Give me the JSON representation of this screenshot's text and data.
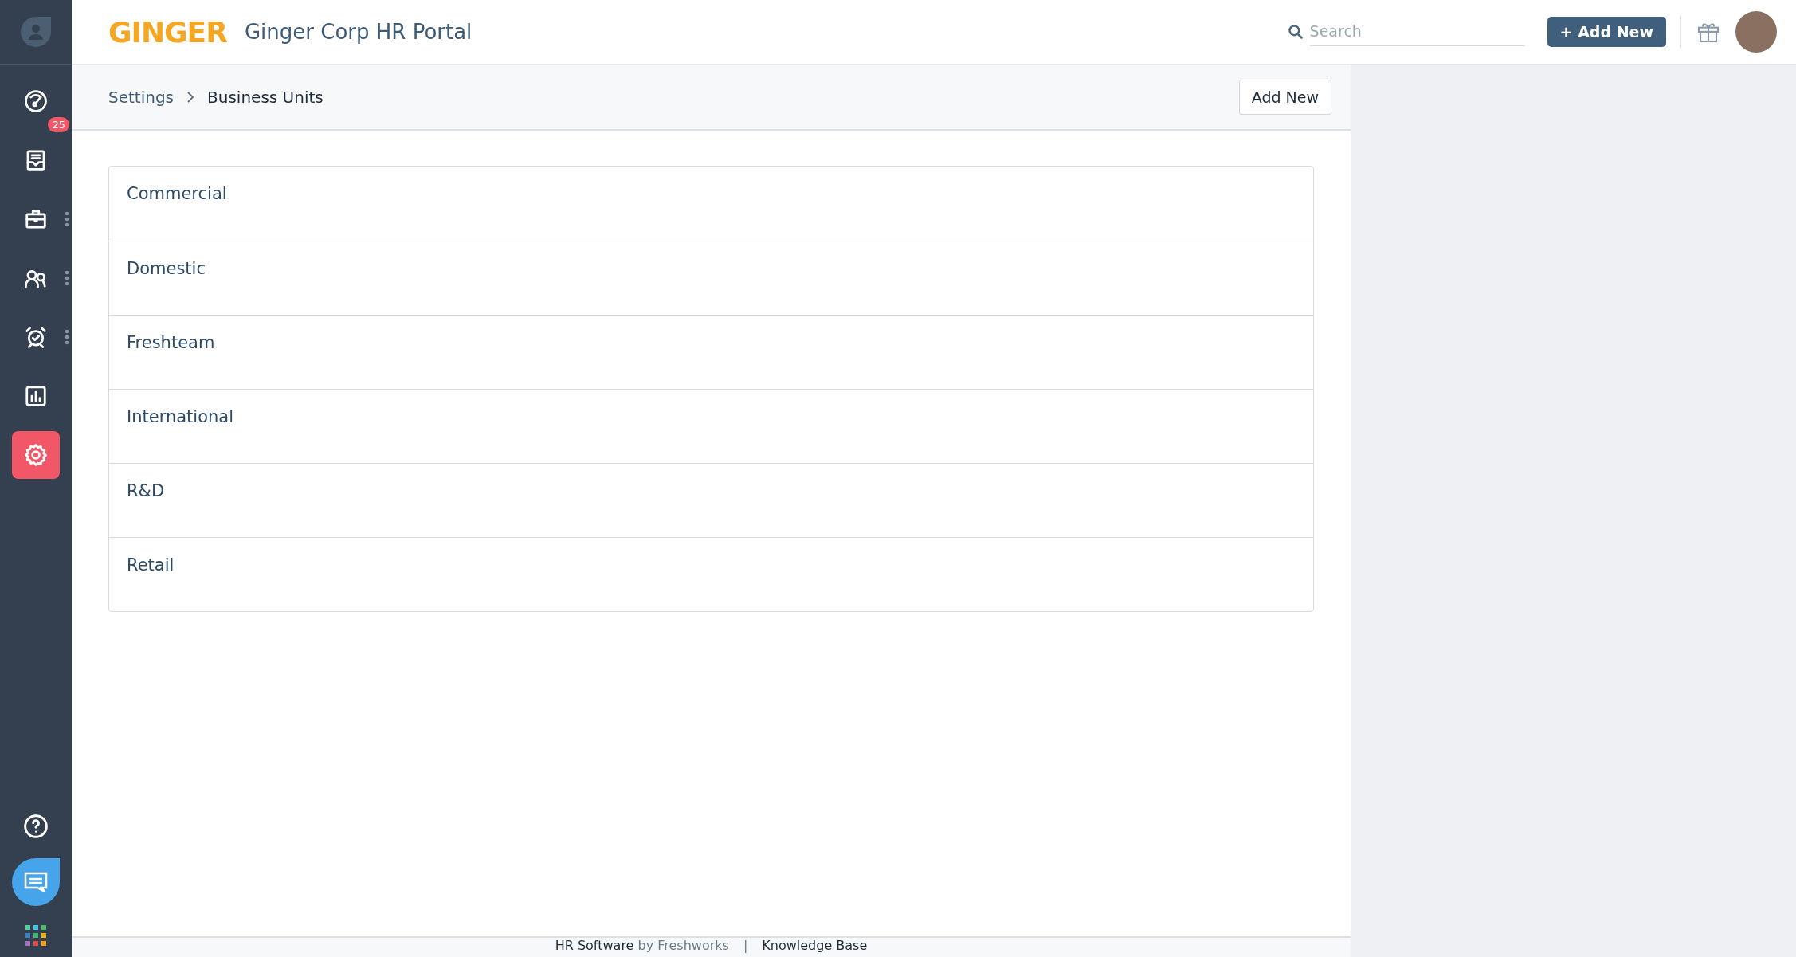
{
  "logo": "GINGER",
  "portal_title": "Ginger Corp HR Portal",
  "search": {
    "placeholder": "Search"
  },
  "add_new_button": "+ Add New",
  "sidebar": {
    "items": [
      {
        "kind": "dashboard",
        "selected": false,
        "menu": false
      },
      {
        "kind": "inbox",
        "selected": false,
        "menu": false,
        "badge": "25"
      },
      {
        "kind": "briefcase",
        "selected": false,
        "menu": true
      },
      {
        "kind": "people",
        "selected": false,
        "menu": true
      },
      {
        "kind": "alarm",
        "selected": false,
        "menu": true
      },
      {
        "kind": "reports",
        "selected": false,
        "menu": false
      },
      {
        "kind": "settings",
        "selected": true,
        "menu": false
      }
    ]
  },
  "breadcrumb": [
    "Settings",
    "Business Units"
  ],
  "page_action": "Add New",
  "business_units": [
    "Commercial",
    "Domestic",
    "Freshteam",
    "International",
    "R&D",
    "Retail"
  ],
  "footer": {
    "product": "HR Software",
    "by": "by Freshworks",
    "separator": "|",
    "link": "Knowledge Base"
  }
}
